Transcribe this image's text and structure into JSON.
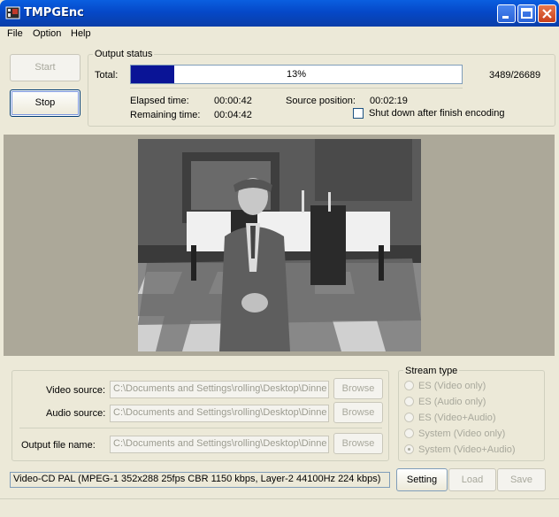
{
  "window": {
    "title": "TMPGEnc"
  },
  "menu": {
    "items": [
      "File",
      "Option",
      "Help"
    ]
  },
  "controls": {
    "start_label": "Start",
    "stop_label": "Stop"
  },
  "output_status": {
    "legend": "Output status",
    "total_label": "Total:",
    "progress_fraction": 0.13,
    "progress_text": "13%",
    "frames": "3489/26689",
    "elapsed_label": "Elapsed time:",
    "elapsed_value": "00:00:42",
    "remaining_label": "Remaining time:",
    "remaining_value": "00:04:42",
    "source_label": "Source position:",
    "source_value": "00:02:19",
    "shutdown_label": "Shut down after finish encoding",
    "shutdown_checked": false
  },
  "files": {
    "video_label": "Video source:",
    "video_value": "C:\\Documents and Settings\\rolling\\Desktop\\Dinne",
    "audio_label": "Audio source:",
    "audio_value": "C:\\Documents and Settings\\rolling\\Desktop\\Dinne",
    "output_label": "Output file name:",
    "output_value": "C:\\Documents and Settings\\rolling\\Desktop\\Dinne",
    "browse_label": "Browse"
  },
  "stream_type": {
    "legend": "Stream type",
    "options": [
      "ES (Video only)",
      "ES (Audio only)",
      "ES (Video+Audio)",
      "System (Video only)",
      "System (Video+Audio)"
    ],
    "selected_index": 4
  },
  "format_summary": "Video-CD PAL (MPEG-1 352x288 25fps CBR 1150 kbps,  Layer-2 44100Hz 224 kbps)",
  "actions": {
    "setting_label": "Setting",
    "load_label": "Load",
    "save_label": "Save"
  },
  "colors": {
    "progress_fill": "#0a1496",
    "titlebar": "#0548c8",
    "preview_bg": "#aca899"
  }
}
